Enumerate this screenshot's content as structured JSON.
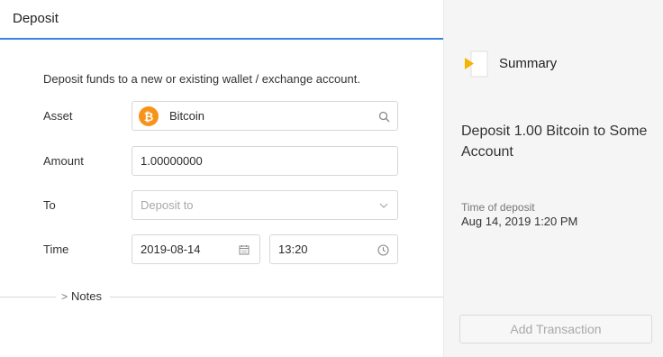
{
  "header": {
    "title": "Deposit"
  },
  "form": {
    "intro": "Deposit funds to a new or existing wallet / exchange account.",
    "asset": {
      "label": "Asset",
      "value": "Bitcoin",
      "icon": "bitcoin-icon",
      "search_icon": "search-icon"
    },
    "amount": {
      "label": "Amount",
      "value": "1.00000000"
    },
    "to": {
      "label": "To",
      "placeholder": "Deposit to",
      "icon": "chevron-down-icon"
    },
    "time": {
      "label": "Time",
      "date": "2019-08-14",
      "time": "13:20",
      "date_icon": "calendar-icon",
      "time_icon": "clock-icon"
    },
    "notes": {
      "label": "Notes",
      "icon": "chevron-right-icon"
    }
  },
  "summary": {
    "title": "Summary",
    "description": "Deposit 1.00 Bitcoin to Some Account",
    "time_label": "Time of deposit",
    "time_value": "Aug 14, 2019 1:20 PM",
    "add_button": "Add Transaction"
  },
  "colors": {
    "accent": "#3b82e6",
    "bitcoin": "#f7931a",
    "summary_icon": "#f5b400"
  }
}
